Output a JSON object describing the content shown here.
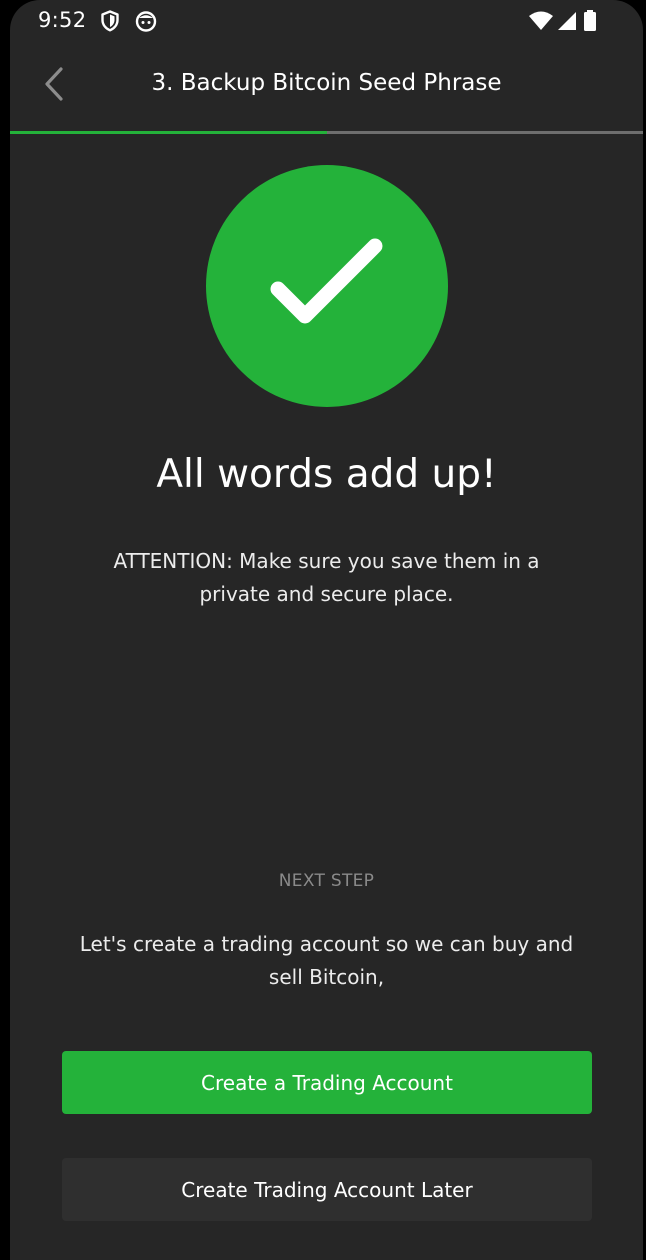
{
  "status_bar": {
    "time": "9:52",
    "left_icons": [
      "shield-icon",
      "cat-face-icon"
    ],
    "right_icons": [
      "wifi-icon",
      "cell-signal-icon",
      "battery-icon"
    ]
  },
  "header": {
    "back_icon": "chevron-left-icon",
    "title": "3. Backup Bitcoin Seed Phrase",
    "progress_fraction": 0.5
  },
  "success": {
    "icon": "checkmark-icon",
    "headline": "All words add up!",
    "attention": "ATTENTION: Make sure you save them in a private and secure place."
  },
  "next_step": {
    "label": "NEXT STEP",
    "text": "Let's create a trading account so we can buy and sell Bitcoin,"
  },
  "actions": {
    "primary_label": "Create a Trading Account",
    "secondary_label": "Create Trading Account Later"
  },
  "colors": {
    "accent": "#24b23a",
    "background": "#262626",
    "secondary_button": "#2f2f2f",
    "progress_track": "#6e6e6e"
  }
}
